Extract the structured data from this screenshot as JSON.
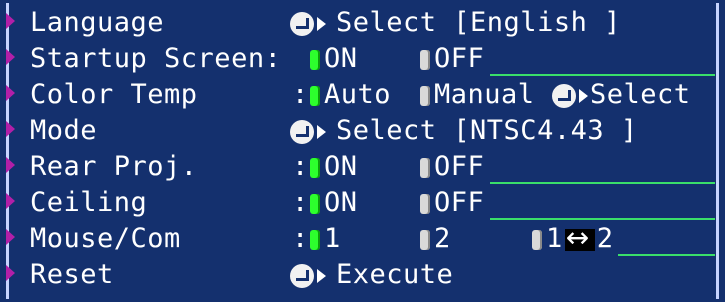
{
  "rows": [
    {
      "label": "Language",
      "select_text": "Select [English   ]"
    },
    {
      "label": "Startup Screen:",
      "opt1": "ON",
      "opt2": "OFF"
    },
    {
      "label": "Color Temp",
      "sep": ":",
      "opt1": "Auto",
      "opt2": "Manual",
      "select_text": "Select"
    },
    {
      "label": "Mode",
      "select_text": "Select [NTSC4.43  ]"
    },
    {
      "label": "Rear Proj.",
      "sep": ":",
      "opt1": "ON",
      "opt2": "OFF"
    },
    {
      "label": "Ceiling",
      "sep": ":",
      "opt1": "ON",
      "opt2": "OFF"
    },
    {
      "label": "Mouse/Com",
      "sep": ":",
      "opt1": "1",
      "opt2": "2",
      "opt3a": "1",
      "opt3b": "2"
    },
    {
      "label": "Reset",
      "select_text": "Execute"
    }
  ],
  "colors": {
    "background": "#14306e",
    "selected_radio": "#2dff2d",
    "underline": "#3adf6a",
    "marker": "#b21fa8"
  },
  "icons": {
    "enter": "enter-icon",
    "arrow": "right-arrow-icon",
    "swap": "left-right-arrow-icon"
  }
}
